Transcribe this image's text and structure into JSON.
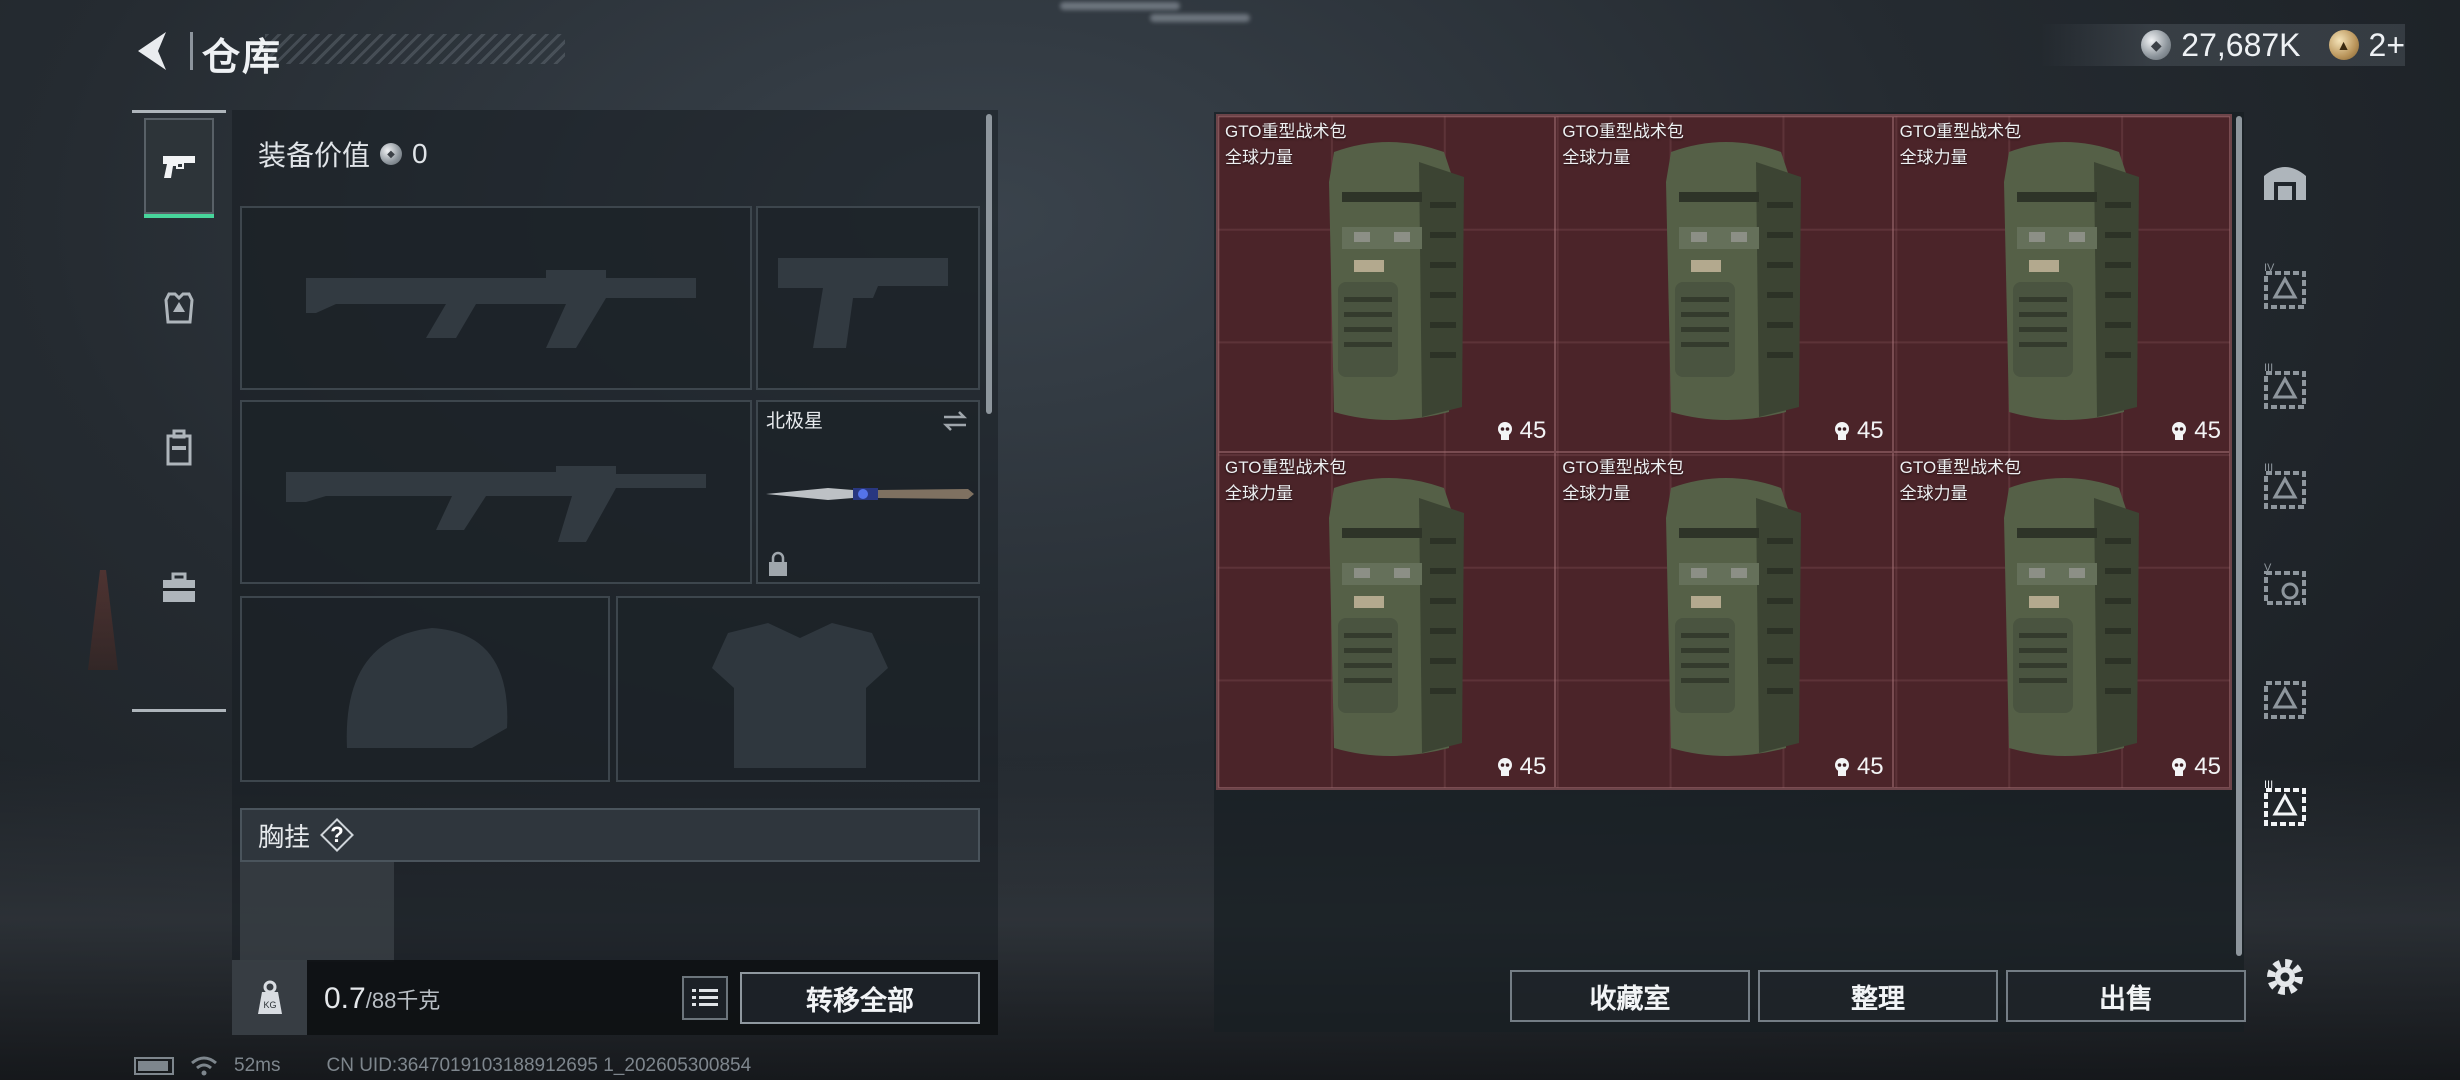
{
  "header": {
    "title": "仓库",
    "currency": [
      {
        "icon": "silver-coin-icon",
        "value": "27,687K"
      },
      {
        "icon": "gold-coin-icon",
        "value": "2+"
      }
    ]
  },
  "left_nav": {
    "items": [
      {
        "name": "weapons-tab",
        "icon": "pistol-icon",
        "active": true
      },
      {
        "name": "armor-tab",
        "icon": "armor-icon",
        "active": false
      },
      {
        "name": "backpack-tab",
        "icon": "backpack-icon",
        "active": false
      },
      {
        "name": "medkit-tab",
        "icon": "medkit-icon",
        "active": false
      }
    ]
  },
  "loadout": {
    "equip_value_label": "装备价值",
    "equip_value": "0",
    "melee_name": "北极星",
    "rig_label": "胸挂",
    "rig_help": "?",
    "weight_current": "0.7",
    "weight_capacity": "/88千克",
    "transfer_all_label": "转移全部"
  },
  "storage": {
    "items": [
      {
        "name": "GTO重型战术包",
        "faction": "全球力量",
        "capacity": "45"
      },
      {
        "name": "GTO重型战术包",
        "faction": "全球力量",
        "capacity": "45"
      },
      {
        "name": "GTO重型战术包",
        "faction": "全球力量",
        "capacity": "45"
      },
      {
        "name": "GTO重型战术包",
        "faction": "全球力量",
        "capacity": "45"
      },
      {
        "name": "GTO重型战术包",
        "faction": "全球力量",
        "capacity": "45"
      },
      {
        "name": "GTO重型战术包",
        "faction": "全球力量",
        "capacity": "45"
      }
    ],
    "buttons": {
      "collection": "收藏室",
      "sort": "整理",
      "sell": "出售"
    }
  },
  "right_tabs": {
    "tiers": [
      "",
      "IV",
      "III",
      "III",
      "V",
      "",
      "III"
    ]
  },
  "status": {
    "ping": "52ms",
    "uid": "CN UID:3647019103188912695 1_202605300854"
  },
  "colors": {
    "accent_green": "#47d59b",
    "storage_red": "#4b2429"
  }
}
